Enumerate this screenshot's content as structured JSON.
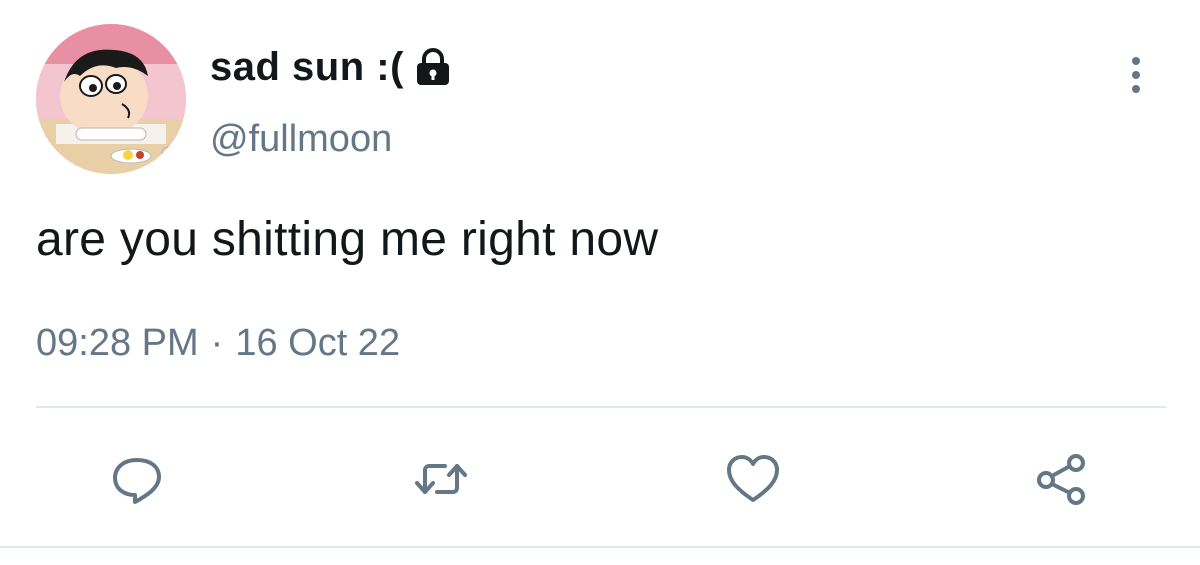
{
  "tweet": {
    "display_name": "sad sun :(",
    "handle": "@fullmoon",
    "text": "are you shitting me right now",
    "time": "09:28 PM",
    "separator": "·",
    "date": "16 Oct 22",
    "protected": true
  },
  "icons": {
    "lock": "lock-icon",
    "more": "more-vertical-icon",
    "reply": "reply-icon",
    "retweet": "retweet-icon",
    "like": "heart-icon",
    "share": "share-icon"
  },
  "colors": {
    "text_primary": "#14171a",
    "text_secondary": "#657786",
    "divider": "#e1e8ed"
  }
}
